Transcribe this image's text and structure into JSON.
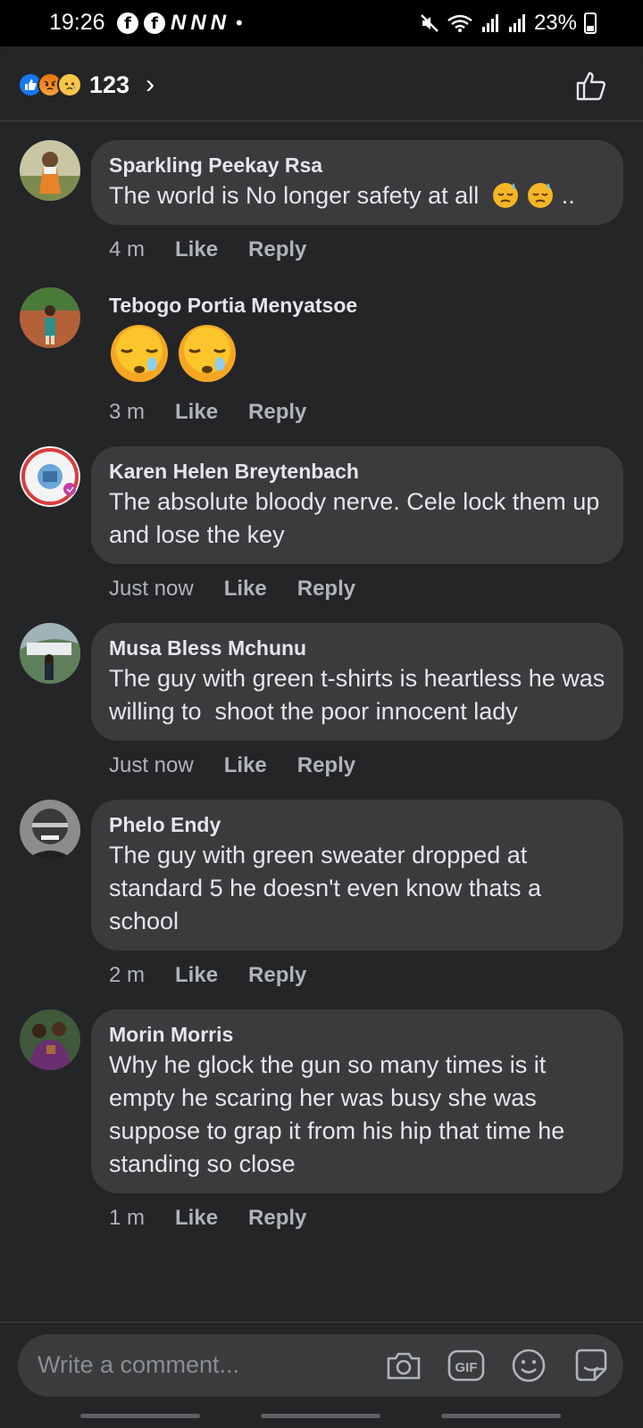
{
  "status_bar": {
    "time": "19:26",
    "battery": "23%"
  },
  "header": {
    "reaction_count": "123",
    "chevron": "›"
  },
  "comments": [
    {
      "author": "Sparkling Peekay Rsa",
      "text": "The world is No longer safety at all",
      "text_tail": " ..",
      "time": "4 m",
      "like": "Like",
      "reply": "Reply"
    },
    {
      "author": "Tebogo Portia Menyatsoe",
      "time": "3 m",
      "like": "Like",
      "reply": "Reply"
    },
    {
      "author": "Karen Helen Breytenbach",
      "text": "The absolute bloody nerve. Cele lock them up and lose the key",
      "time": "Just now",
      "like": "Like",
      "reply": "Reply"
    },
    {
      "author": "Musa Bless Mchunu",
      "text": "The guy with green t-shirts is heartless he was willing to  shoot the poor innocent lady",
      "time": "Just now",
      "like": "Like",
      "reply": "Reply"
    },
    {
      "author": "Phelo Endy",
      "text": "The guy with green sweater dropped at standard 5 he doesn't even know thats a school",
      "time": "2 m",
      "like": "Like",
      "reply": "Reply"
    },
    {
      "author": "Morin Morris",
      "text": "Why he glock the gun so many times is it empty he scaring her was busy she was suppose to grap it from his hip that time he standing so close",
      "time": "1 m",
      "like": "Like",
      "reply": "Reply"
    }
  ],
  "composer": {
    "placeholder": "Write a comment...",
    "gif_label": "GIF"
  },
  "icons": {
    "reactions": [
      "like-reaction-icon",
      "angry-reaction-icon",
      "sad-reaction-icon"
    ],
    "header": "thumbs-up-outline-icon",
    "composer": [
      "camera-icon",
      "gif-icon",
      "emoji-icon",
      "sticker-icon"
    ]
  },
  "colors": {
    "background": "#242527",
    "bubble": "#3a3b3c",
    "secondary_text": "#b0b3b8",
    "like_blue": "#1877f2"
  }
}
